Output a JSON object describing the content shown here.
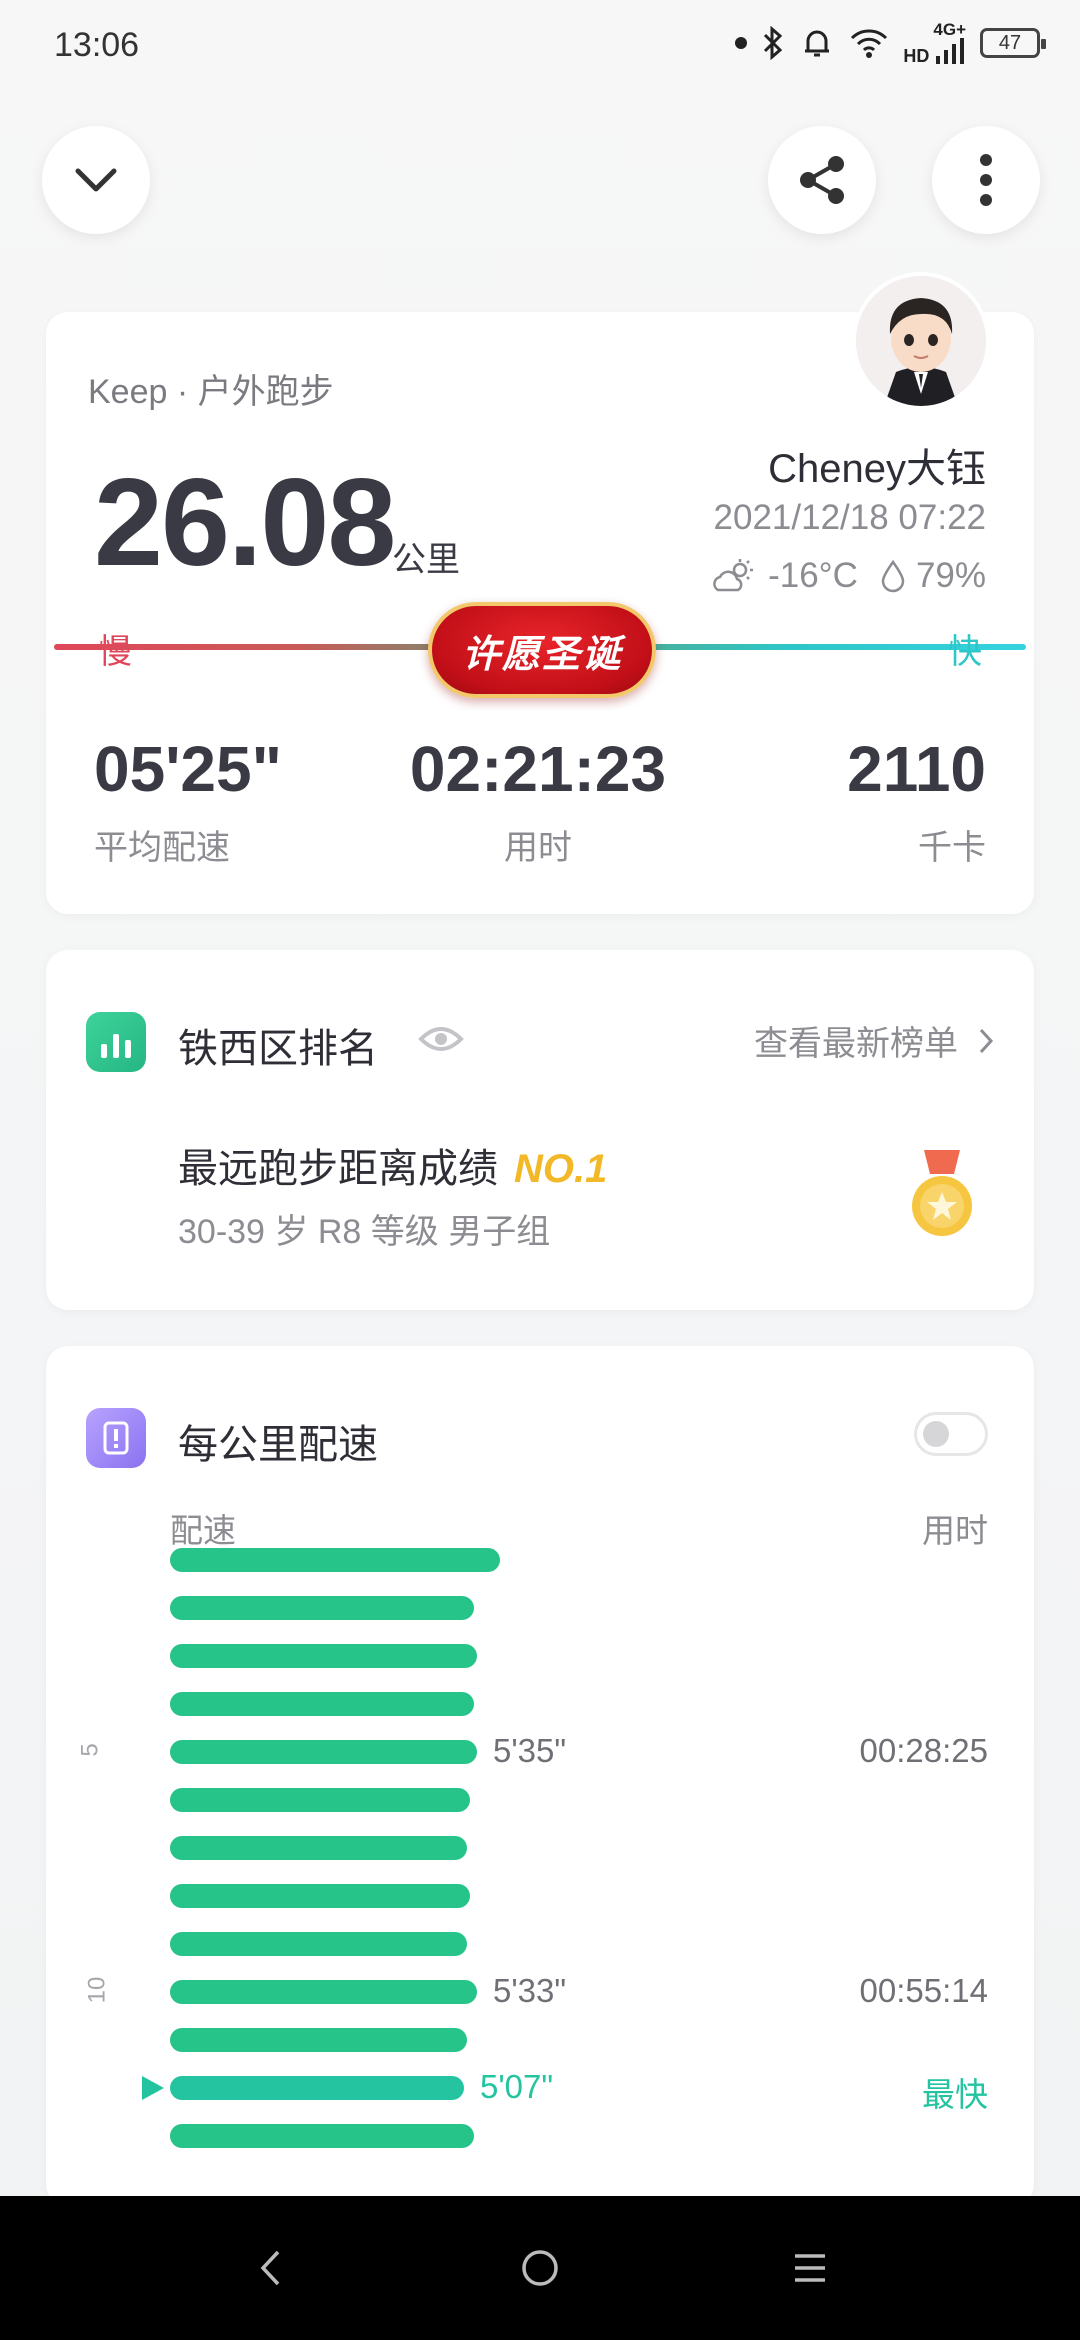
{
  "status": {
    "time": "13:06",
    "network": "4G+",
    "hd": "HD",
    "battery": "47",
    "icons": [
      "bluetooth-icon",
      "bell-icon",
      "wifi-icon",
      "signal-icon",
      "battery-icon"
    ]
  },
  "summary": {
    "app_label": "Keep · 户外跑步",
    "distance": "26.08",
    "distance_unit": "公里",
    "user_name": "Cheney大钰",
    "datetime": "2021/12/18 07:22",
    "temperature": "-16°C",
    "humidity": "79%",
    "slow_label": "慢",
    "fast_label": "快",
    "badge_text": "许愿圣诞",
    "stats": [
      {
        "value": "05'25\"",
        "label": "平均配速"
      },
      {
        "value": "02:21:23",
        "label": "用时"
      },
      {
        "value": "2110",
        "label": "千卡"
      }
    ]
  },
  "ranking": {
    "title": "铁西区排名",
    "link": "查看最新榜单",
    "main": "最远跑步距离成绩",
    "rank": "NO.1",
    "sub": "30-39 岁 R8 等级 男子组"
  },
  "pace": {
    "title": "每公里配速",
    "col_pace": "配速",
    "col_time": "用时",
    "km_marks": [
      "5",
      "10"
    ],
    "rows": [
      {
        "fraction": 1.0
      },
      {
        "fraction": 0.92
      },
      {
        "fraction": 0.93
      },
      {
        "fraction": 0.92
      },
      {
        "fraction": 0.93,
        "pace": "5'35\"",
        "time": "00:28:25"
      },
      {
        "fraction": 0.91
      },
      {
        "fraction": 0.9
      },
      {
        "fraction": 0.91
      },
      {
        "fraction": 0.9
      },
      {
        "fraction": 0.93,
        "pace": "5'33\"",
        "time": "00:55:14"
      },
      {
        "fraction": 0.9
      },
      {
        "fraction": 0.89,
        "pace": "5'07\"",
        "time": "最快",
        "fastest": true
      },
      {
        "fraction": 0.92
      }
    ]
  },
  "colors": {
    "accent_green": "#26c489",
    "slow_red": "#e0475a",
    "fast_cyan": "#2ec6c7",
    "gold": "#f3b827"
  }
}
